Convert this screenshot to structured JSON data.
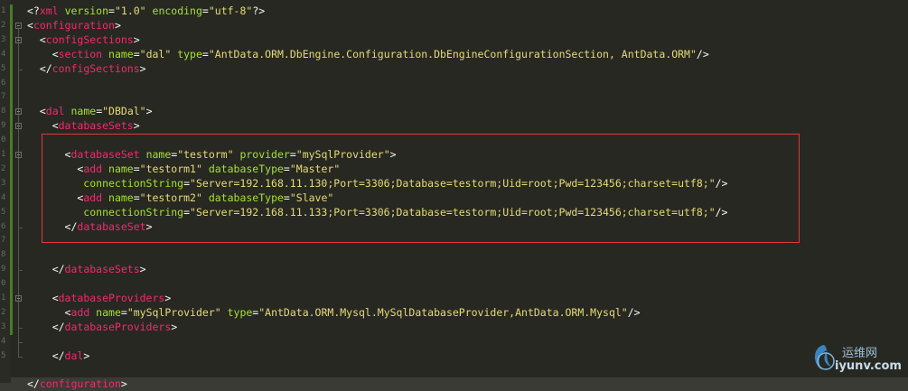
{
  "gutter": {
    "line_numbers": [
      "1",
      "2",
      "3",
      "4",
      "5",
      "6",
      "7",
      "8",
      "9",
      "0",
      "1",
      "2",
      "3",
      "4",
      "5",
      "6",
      "7",
      "8",
      "9",
      "0",
      "1",
      "2",
      "3",
      "4",
      "5"
    ]
  },
  "code_lines": [
    [
      [
        "<?",
        "b"
      ],
      [
        "xml",
        "tag"
      ],
      [
        " version",
        "attr"
      ],
      [
        "=",
        "b"
      ],
      [
        "\"1.0\"",
        "str"
      ],
      [
        " encoding",
        "attr"
      ],
      [
        "=",
        "b"
      ],
      [
        "\"utf-8\"",
        "str"
      ],
      [
        "?>",
        "b"
      ]
    ],
    [
      [
        "<",
        "b"
      ],
      [
        "configuration",
        "tag"
      ],
      [
        ">",
        "b"
      ]
    ],
    [
      [
        "  <",
        "b"
      ],
      [
        "configSections",
        "tag"
      ],
      [
        ">",
        "b"
      ]
    ],
    [
      [
        "    <",
        "b"
      ],
      [
        "section",
        "tag"
      ],
      [
        " name",
        "attr"
      ],
      [
        "=",
        "b"
      ],
      [
        "\"dal\"",
        "str"
      ],
      [
        " type",
        "attr"
      ],
      [
        "=",
        "b"
      ],
      [
        "\"AntData.ORM.DbEngine.Configuration.DbEngineConfigurationSection, AntData.ORM\"",
        "str"
      ],
      [
        "/>",
        "b"
      ]
    ],
    [
      [
        "  </",
        "b"
      ],
      [
        "configSections",
        "tag"
      ],
      [
        ">",
        "b"
      ]
    ],
    [],
    [],
    [
      [
        "  <",
        "b"
      ],
      [
        "dal",
        "tag"
      ],
      [
        " name",
        "attr"
      ],
      [
        "=",
        "b"
      ],
      [
        "\"DBDal\"",
        "str"
      ],
      [
        ">",
        "b"
      ]
    ],
    [
      [
        "    <",
        "b"
      ],
      [
        "databaseSets",
        "tag"
      ],
      [
        ">",
        "b"
      ]
    ],
    [],
    [
      [
        "      <",
        "b"
      ],
      [
        "databaseSet",
        "tag"
      ],
      [
        " name",
        "attr"
      ],
      [
        "=",
        "b"
      ],
      [
        "\"testorm\"",
        "str"
      ],
      [
        " provider",
        "attr"
      ],
      [
        "=",
        "b"
      ],
      [
        "\"mySqlProvider\"",
        "str"
      ],
      [
        ">",
        "b"
      ]
    ],
    [
      [
        "        <",
        "b"
      ],
      [
        "add",
        "tag"
      ],
      [
        " name",
        "attr"
      ],
      [
        "=",
        "b"
      ],
      [
        "\"testorm1\"",
        "str"
      ],
      [
        " databaseType",
        "attr"
      ],
      [
        "=",
        "b"
      ],
      [
        "\"Master\"",
        "str"
      ]
    ],
    [
      [
        "         connectionString",
        "attr"
      ],
      [
        "=",
        "b"
      ],
      [
        "\"Server=192.168.11.130;Port=3306;Database=testorm;Uid=root;Pwd=123456;charset=utf8;\"",
        "str"
      ],
      [
        "/>",
        "b"
      ]
    ],
    [
      [
        "        <",
        "b"
      ],
      [
        "add",
        "tag"
      ],
      [
        " name",
        "attr"
      ],
      [
        "=",
        "b"
      ],
      [
        "\"testorm2\"",
        "str"
      ],
      [
        " databaseType",
        "attr"
      ],
      [
        "=",
        "b"
      ],
      [
        "\"Slave\"",
        "str"
      ]
    ],
    [
      [
        "         connectionString",
        "attr"
      ],
      [
        "=",
        "b"
      ],
      [
        "\"Server=192.168.11.133;Port=3306;Database=testorm;Uid=root;Pwd=123456;charset=utf8;\"",
        "str"
      ],
      [
        "/>",
        "b"
      ]
    ],
    [
      [
        "      </",
        "b"
      ],
      [
        "databaseSet",
        "tag"
      ],
      [
        ">",
        "b"
      ]
    ],
    [],
    [],
    [
      [
        "    </",
        "b"
      ],
      [
        "databaseSets",
        "tag"
      ],
      [
        ">",
        "b"
      ]
    ],
    [],
    [
      [
        "    <",
        "b"
      ],
      [
        "databaseProviders",
        "tag"
      ],
      [
        ">",
        "b"
      ]
    ],
    [
      [
        "      <",
        "b"
      ],
      [
        "add",
        "tag"
      ],
      [
        " name",
        "attr"
      ],
      [
        "=",
        "b"
      ],
      [
        "\"mySqlProvider\"",
        "str"
      ],
      [
        " type",
        "attr"
      ],
      [
        "=",
        "b"
      ],
      [
        "\"AntData.ORM.Mysql.MySqlDatabaseProvider,AntData.ORM.Mysql\"",
        "str"
      ],
      [
        "/>",
        "b"
      ]
    ],
    [
      [
        "    </",
        "b"
      ],
      [
        "databaseProviders",
        "tag"
      ],
      [
        ">",
        "b"
      ]
    ],
    [],
    [
      [
        "    </",
        "b"
      ],
      [
        "dal",
        "tag"
      ],
      [
        ">",
        "b"
      ]
    ],
    [],
    [
      [
        "</",
        "b"
      ],
      [
        "configuration",
        "tag"
      ],
      [
        ">",
        "b"
      ]
    ]
  ],
  "watermark": {
    "cn_text": "运维网",
    "url": "iyunv.com"
  }
}
